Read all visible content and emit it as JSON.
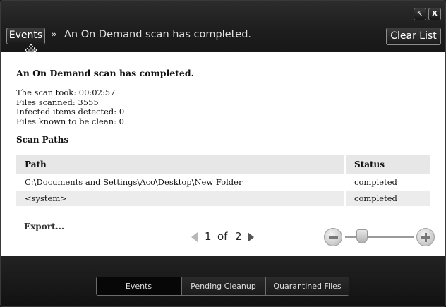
{
  "window": {
    "restore_label": "↖",
    "close_label": "X"
  },
  "header": {
    "events_button": "Events",
    "separator": "»",
    "title": "An On Demand scan has completed.",
    "clear_button": "Clear List"
  },
  "content": {
    "heading": "An On Demand scan has completed.",
    "stats": [
      "The scan took: 00:02:57",
      "Files scanned: 3555",
      "Infected items detected: 0",
      "Files known to be clean: 0"
    ],
    "scan_paths_title": "Scan Paths",
    "table": {
      "headers": [
        "Path",
        "Status"
      ],
      "rows": [
        {
          "path": "C:\\Documents and Settings\\Aco\\Desktop\\New Folder",
          "status": "completed"
        },
        {
          "path": "<system>",
          "status": "completed"
        }
      ]
    },
    "export_label": "Export...",
    "pager": {
      "current": "1",
      "of": "of",
      "total": "2"
    },
    "zoom": {
      "level": 0.25
    }
  },
  "tabs": [
    "Events",
    "Pending Cleanup",
    "Quarantined Files"
  ],
  "active_tab": "Events",
  "colors": {
    "background": "#1b1b1b",
    "content": "#ffffff",
    "header_row": "#e7e7e7"
  }
}
